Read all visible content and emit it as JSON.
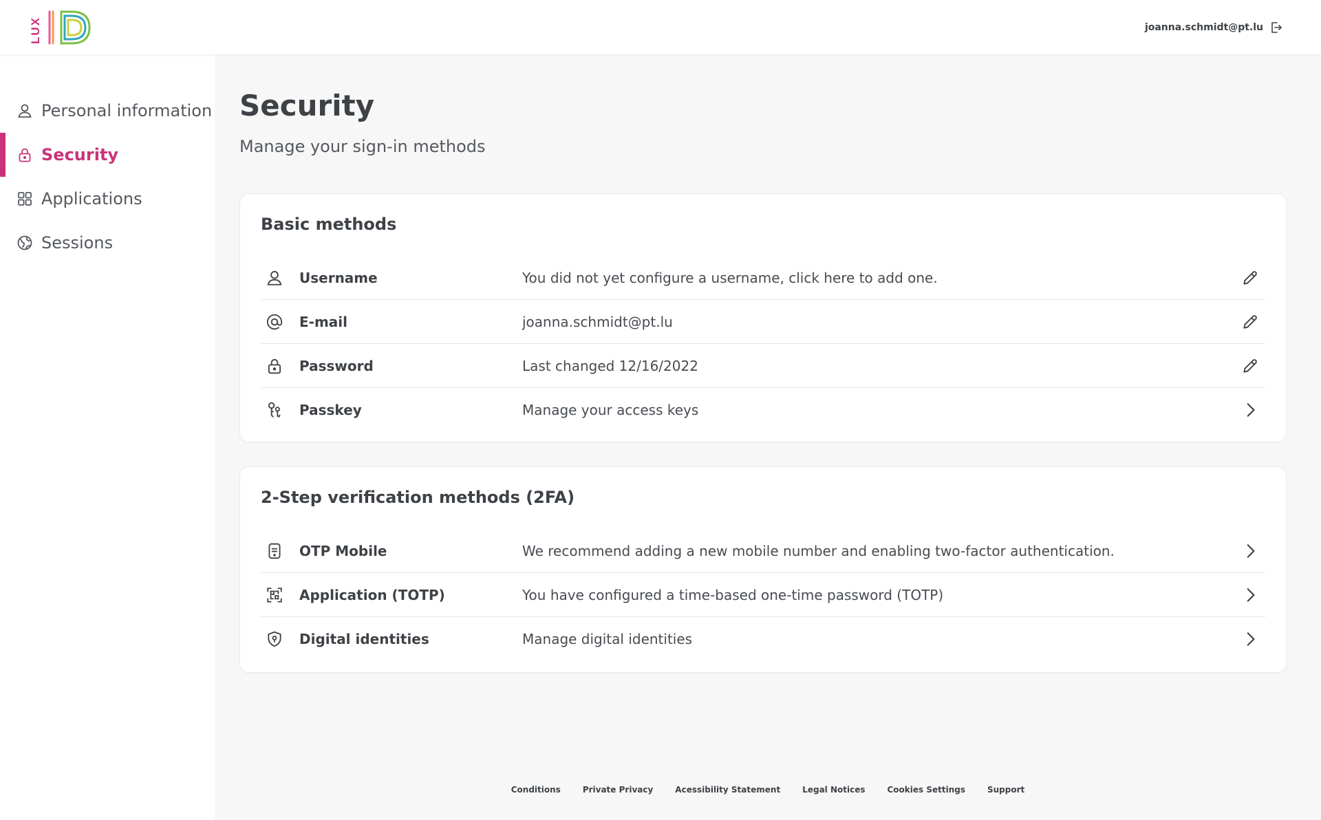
{
  "colors": {
    "accent": "#c9337a",
    "text": "#3e4246",
    "muted": "#55595e",
    "background": "#f7f7f7",
    "card": "#ffffff"
  },
  "header": {
    "logo_text": "LUX ID",
    "user_email": "joanna.schmidt@pt.lu",
    "logout_icon": "logout-icon"
  },
  "sidebar": {
    "items": [
      {
        "label": "Personal information",
        "icon": "user-icon",
        "active": false
      },
      {
        "label": "Security",
        "icon": "lock-icon",
        "active": true
      },
      {
        "label": "Applications",
        "icon": "grid-icon",
        "active": false
      },
      {
        "label": "Sessions",
        "icon": "globe-icon",
        "active": false
      }
    ]
  },
  "main": {
    "title": "Security",
    "subtitle": "Manage your sign-in methods",
    "basic": {
      "title": "Basic methods",
      "rows": [
        {
          "label": "Username",
          "value": "You did not yet configure a username, click here to add one.",
          "icon": "user-icon",
          "action": "edit-icon"
        },
        {
          "label": "E-mail",
          "value": "joanna.schmidt@pt.lu",
          "icon": "at-icon",
          "action": "edit-icon"
        },
        {
          "label": "Password",
          "value": "Last changed 12/16/2022",
          "icon": "lock-icon",
          "action": "edit-icon"
        },
        {
          "label": "Passkey",
          "value": "Manage your access keys",
          "icon": "passkey-icon",
          "action": "chevron-right-icon"
        }
      ]
    },
    "twofa": {
      "title": "2-Step verification methods (2FA)",
      "rows": [
        {
          "label": "OTP Mobile",
          "value": "We recommend adding a new mobile number and enabling two-factor authentication.",
          "icon": "mobile-otp-icon",
          "action": "chevron-right-icon"
        },
        {
          "label": "Application (TOTP)",
          "value": "You have configured a time-based one-time password (TOTP)",
          "icon": "qr-scan-icon",
          "action": "chevron-right-icon"
        },
        {
          "label": "Digital identities",
          "value": "Manage digital identities",
          "icon": "shield-icon",
          "action": "chevron-right-icon"
        }
      ]
    }
  },
  "footer": {
    "links": [
      "Conditions",
      "Private Privacy",
      "Acessibility Statement",
      "Legal Notices",
      "Cookies Settings",
      "Support"
    ]
  }
}
